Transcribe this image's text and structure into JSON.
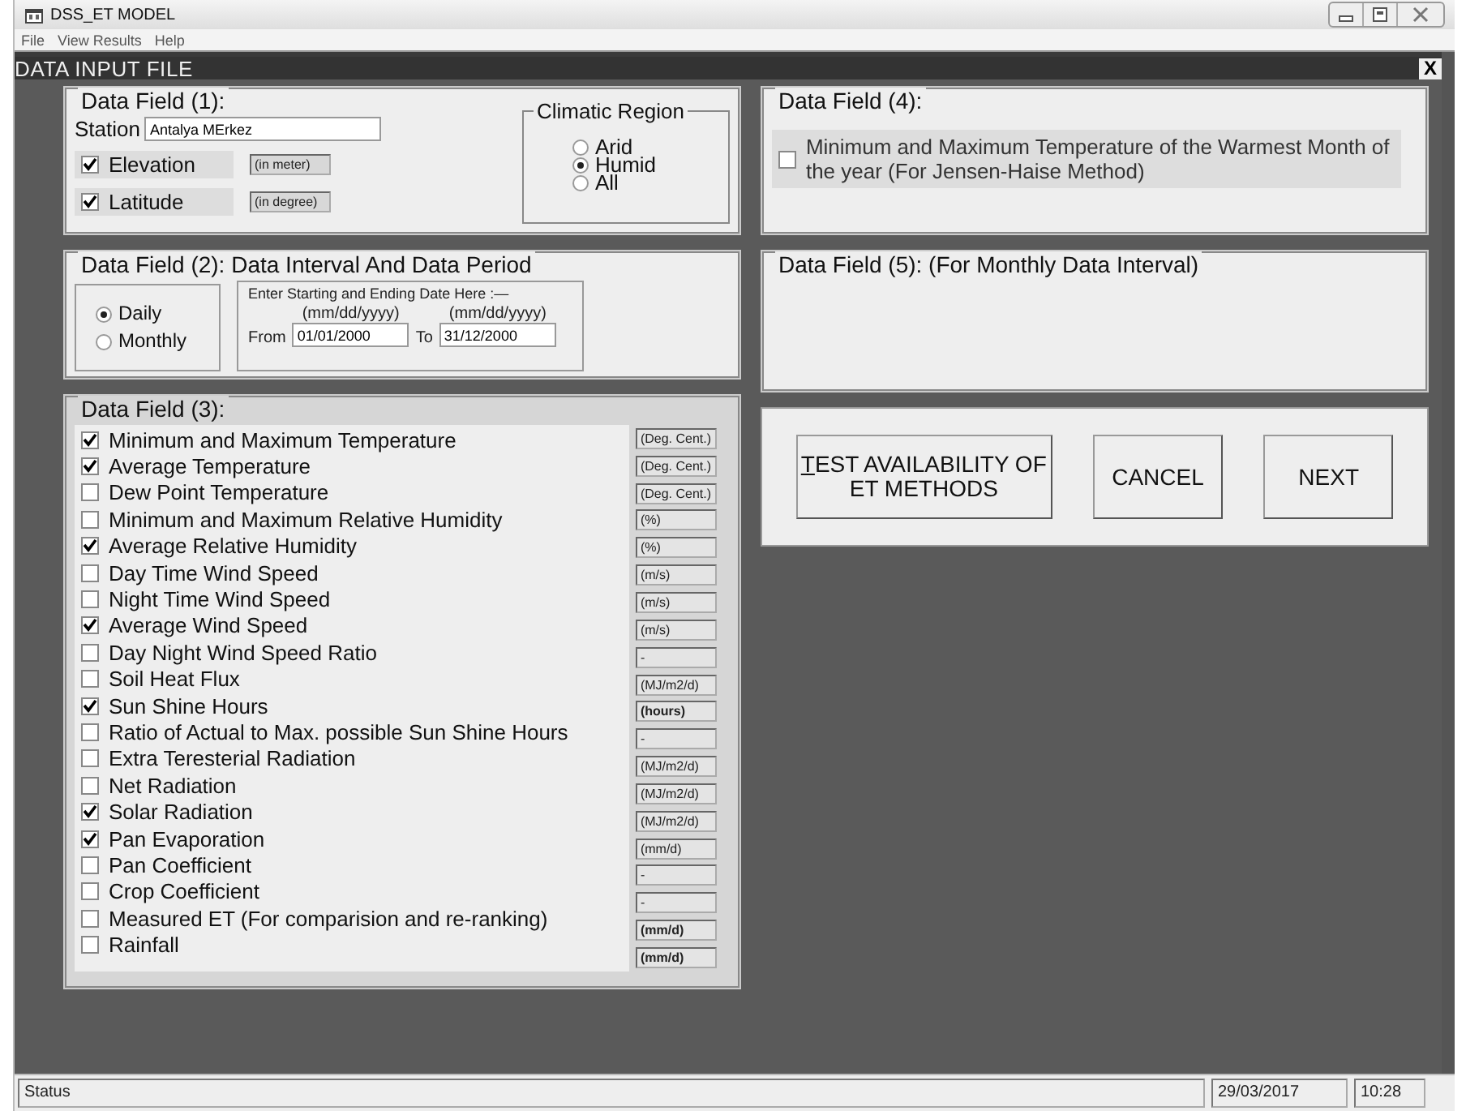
{
  "window": {
    "title": "DSS_ET MODEL"
  },
  "menu": [
    "File",
    "View Results",
    "Help"
  ],
  "child_window": {
    "title": "DATA INPUT FILE",
    "close": "X"
  },
  "field1": {
    "legend": "Data Field (1):",
    "station_label": "Station",
    "station_value": "Antalya MErkez",
    "checks": [
      {
        "label": "Elevation",
        "checked": true,
        "unit": "(in meter)"
      },
      {
        "label": "Latitude",
        "checked": true,
        "unit": "(in degree)"
      }
    ],
    "region": {
      "legend": "Climatic Region",
      "options": [
        {
          "label": "Arid",
          "selected": false
        },
        {
          "label": "Humid",
          "selected": true
        },
        {
          "label": "All",
          "selected": false
        }
      ]
    }
  },
  "field2": {
    "legend": "Data Field (2): Data Interval And Data Period",
    "interval": [
      {
        "label": "Daily",
        "selected": true
      },
      {
        "label": "Monthly",
        "selected": false
      }
    ],
    "period_hint": "Enter Starting and Ending Date Here :—",
    "from": {
      "label": "From",
      "format": "(mm/dd/yyyy)",
      "value": "01/01/2000"
    },
    "to": {
      "label": "To",
      "format": "(mm/dd/yyyy)",
      "value": "31/12/2000"
    }
  },
  "field3": {
    "legend": "Data Field (3):",
    "items": [
      {
        "label": "Minimum and Maximum Temperature",
        "checked": true,
        "unit": "(Deg. Cent.)",
        "unit_bold": false
      },
      {
        "label": "Average Temperature",
        "checked": true,
        "unit": "(Deg. Cent.)",
        "unit_bold": false
      },
      {
        "label": "Dew Point Temperature",
        "checked": false,
        "unit": "(Deg. Cent.)",
        "unit_bold": false
      },
      {
        "label": "Minimum and Maximum Relative Humidity",
        "checked": false,
        "unit": "(%)",
        "unit_bold": false
      },
      {
        "label": "Average Relative Humidity",
        "checked": true,
        "unit": "(%)",
        "unit_bold": false
      },
      {
        "label": "Day Time Wind Speed",
        "checked": false,
        "unit": "(m/s)",
        "unit_bold": false
      },
      {
        "label": "Night Time Wind Speed",
        "checked": false,
        "unit": "(m/s)",
        "unit_bold": false
      },
      {
        "label": "Average Wind Speed",
        "checked": true,
        "unit": "(m/s)",
        "unit_bold": false
      },
      {
        "label": "Day Night Wind Speed Ratio",
        "checked": false,
        "unit": "-",
        "unit_bold": false
      },
      {
        "label": "Soil Heat Flux",
        "checked": false,
        "unit": "(MJ/m2/d)",
        "unit_bold": false
      },
      {
        "label": "Sun Shine Hours",
        "checked": true,
        "unit": "(hours)",
        "unit_bold": true
      },
      {
        "label": "Ratio of Actual to Max. possible Sun Shine Hours",
        "checked": false,
        "unit": "-",
        "unit_bold": false
      },
      {
        "label": "Extra Teresterial Radiation",
        "checked": false,
        "unit": "(MJ/m2/d)",
        "unit_bold": false
      },
      {
        "label": "Net Radiation",
        "checked": false,
        "unit": "(MJ/m2/d)",
        "unit_bold": false
      },
      {
        "label": "Solar Radiation",
        "checked": true,
        "unit": "(MJ/m2/d)",
        "unit_bold": false
      },
      {
        "label": "Pan Evaporation",
        "checked": true,
        "unit": "(mm/d)",
        "unit_bold": false
      },
      {
        "label": "Pan Coefficient",
        "checked": false,
        "unit": "-",
        "unit_bold": false
      },
      {
        "label": "Crop Coefficient",
        "checked": false,
        "unit": "-",
        "unit_bold": false
      },
      {
        "label": "Measured ET (For comparision and re-ranking)",
        "checked": false,
        "unit": "(mm/d)",
        "unit_bold": true
      },
      {
        "label": "Rainfall",
        "checked": false,
        "unit": "(mm/d)",
        "unit_bold": true
      }
    ]
  },
  "field4": {
    "legend": "Data Field (4):",
    "check": {
      "label": "Minimum and Maximum Temperature of the Warmest Month of the year (For Jensen-Haise Method)",
      "checked": false
    }
  },
  "field5": {
    "legend": "Data Field (5): (For Monthly Data Interval)"
  },
  "buttons": [
    "TEST AVAILABILITY OF ET METHODS",
    "CANCEL",
    "NEXT"
  ],
  "status_bar": {
    "text": "Status",
    "date": "29/03/2017",
    "time": "10:28"
  }
}
